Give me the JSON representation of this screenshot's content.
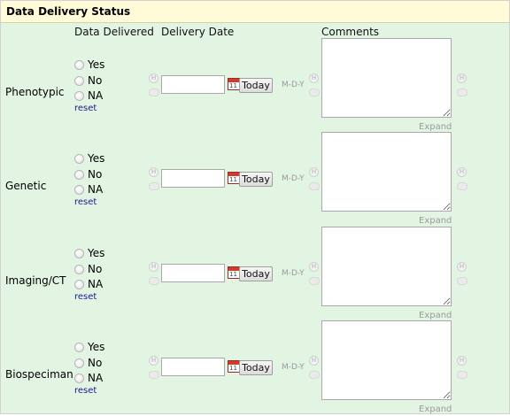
{
  "panel": {
    "title": "Data Delivery Status"
  },
  "columns": {
    "delivered": "Data Delivered",
    "date": "Delivery Date",
    "comments": "Comments"
  },
  "options": {
    "yes": "Yes",
    "no": "No",
    "na": "NA",
    "reset": "reset"
  },
  "controls": {
    "today": "Today",
    "date_format": "M-D-Y",
    "expand": "Expand",
    "note_glyph": "H"
  },
  "rows": [
    {
      "label": "Phenotypic",
      "date_value": "",
      "comment": ""
    },
    {
      "label": "Genetic",
      "date_value": "",
      "comment": ""
    },
    {
      "label": "Imaging/CT",
      "date_value": "",
      "comment": ""
    },
    {
      "label": "Biospeciman",
      "date_value": "",
      "comment": ""
    }
  ],
  "icons": {
    "radio": "radio-button",
    "note": "field-note-icon",
    "comment": "comment-bubble-icon",
    "calendar": "calendar-icon"
  },
  "colors": {
    "panel_bg": "#e2f4e2",
    "header_bg": "#fffbd8",
    "reset_link": "#1a1a8c",
    "calendar_red": "#d23a2a"
  }
}
